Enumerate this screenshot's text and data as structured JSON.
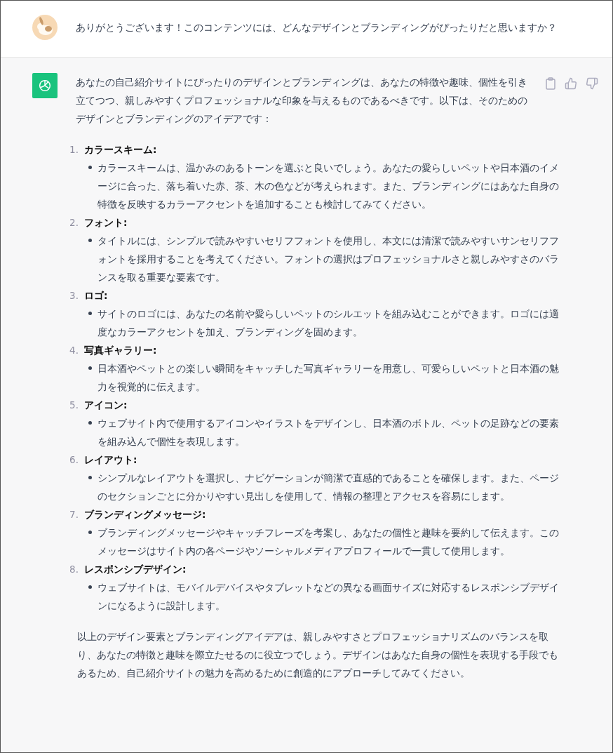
{
  "user_message": {
    "text": "ありがとうございます！このコンテンツには、どんなデザインとブランディングがぴったりだと思いますか？"
  },
  "assistant_message": {
    "intro": "あなたの自己紹介サイトにぴったりのデザインとブランディングは、あなたの特徴や趣味、個性を引き立てつつ、親しみやすくプロフェッショナルな印象を与えるものであるべきです。以下は、そのためのデザインとブランディングのアイデアです：",
    "items": [
      {
        "number": "1.",
        "title": "カラースキーム:",
        "bullets": [
          "カラースキームは、温かみのあるトーンを選ぶと良いでしょう。あなたの愛らしいペットや日本酒のイメージに合った、落ち着いた赤、茶、木の色などが考えられます。また、ブランディングにはあなた自身の特徴を反映するカラーアクセントを追加することも検討してみてください。"
        ]
      },
      {
        "number": "2.",
        "title": "フォント:",
        "bullets": [
          "タイトルには、シンプルで読みやすいセリフフォントを使用し、本文には清潔で読みやすいサンセリフフォントを採用することを考えてください。フォントの選択はプロフェッショナルさと親しみやすさのバランスを取る重要な要素です。"
        ]
      },
      {
        "number": "3.",
        "title": "ロゴ:",
        "bullets": [
          "サイトのロゴには、あなたの名前や愛らしいペットのシルエットを組み込むことができます。ロゴには適度なカラーアクセントを加え、ブランディングを固めます。"
        ]
      },
      {
        "number": "4.",
        "title": "写真ギャラリー:",
        "bullets": [
          "日本酒やペットとの楽しい瞬間をキャッチした写真ギャラリーを用意し、可愛らしいペットと日本酒の魅力を視覚的に伝えます。"
        ]
      },
      {
        "number": "5.",
        "title": "アイコン:",
        "bullets": [
          "ウェブサイト内で使用するアイコンやイラストをデザインし、日本酒のボトル、ペットの足跡などの要素を組み込んで個性を表現します。"
        ]
      },
      {
        "number": "6.",
        "title": "レイアウト:",
        "bullets": [
          "シンプルなレイアウトを選択し、ナビゲーションが簡潔で直感的であることを確保します。また、ページのセクションごとに分かりやすい見出しを使用して、情報の整理とアクセスを容易にします。"
        ]
      },
      {
        "number": "7.",
        "title": "ブランディングメッセージ:",
        "bullets": [
          "ブランディングメッセージやキャッチフレーズを考案し、あなたの個性と趣味を要約して伝えます。このメッセージはサイト内の各ページやソーシャルメディアプロフィールで一貫して使用します。"
        ]
      },
      {
        "number": "8.",
        "title": "レスポンシブデザイン:",
        "bullets": [
          "ウェブサイトは、モバイルデバイスやタブレットなどの異なる画面サイズに対応するレスポンシブデザインになるように設計します。"
        ]
      }
    ],
    "conclusion": "以上のデザイン要素とブランディングアイデアは、親しみやすさとプロフェッショナリズムのバランスを取り、あなたの特徴と趣味を際立たせるのに役立つでしょう。デザインはあなた自身の個性を表現する手段でもあるため、自己紹介サイトの魅力を高めるために創造的にアプローチしてみてください。"
  }
}
